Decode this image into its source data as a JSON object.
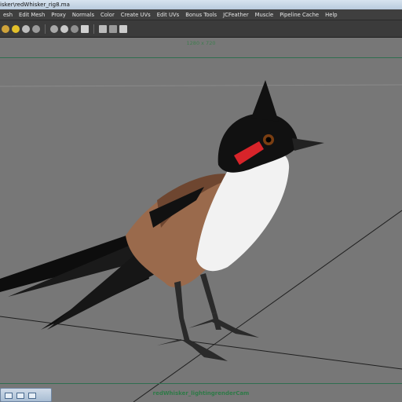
{
  "window": {
    "title": "isker\\redWhisker_rig8.ma"
  },
  "menubar": {
    "items": [
      "esh",
      "Edit Mesh",
      "Proxy",
      "Normals",
      "Color",
      "Create UVs",
      "Edit UVs",
      "Bonus Tools",
      "JCFeather",
      "Muscle",
      "Pipeline Cache",
      "Help"
    ]
  },
  "viewport": {
    "resolution_gate_label": "1280 x 720",
    "camera_name": "redWhisker_lightingrenderCam",
    "background_color": "#777777"
  },
  "colors": {
    "gate_line": "#2f6e4f",
    "camera_label": "#2f7a48",
    "bird_black": "#111111",
    "bird_white": "#f2f2f2",
    "bird_brown": "#9a6a4c",
    "bird_red": "#d8242a"
  }
}
